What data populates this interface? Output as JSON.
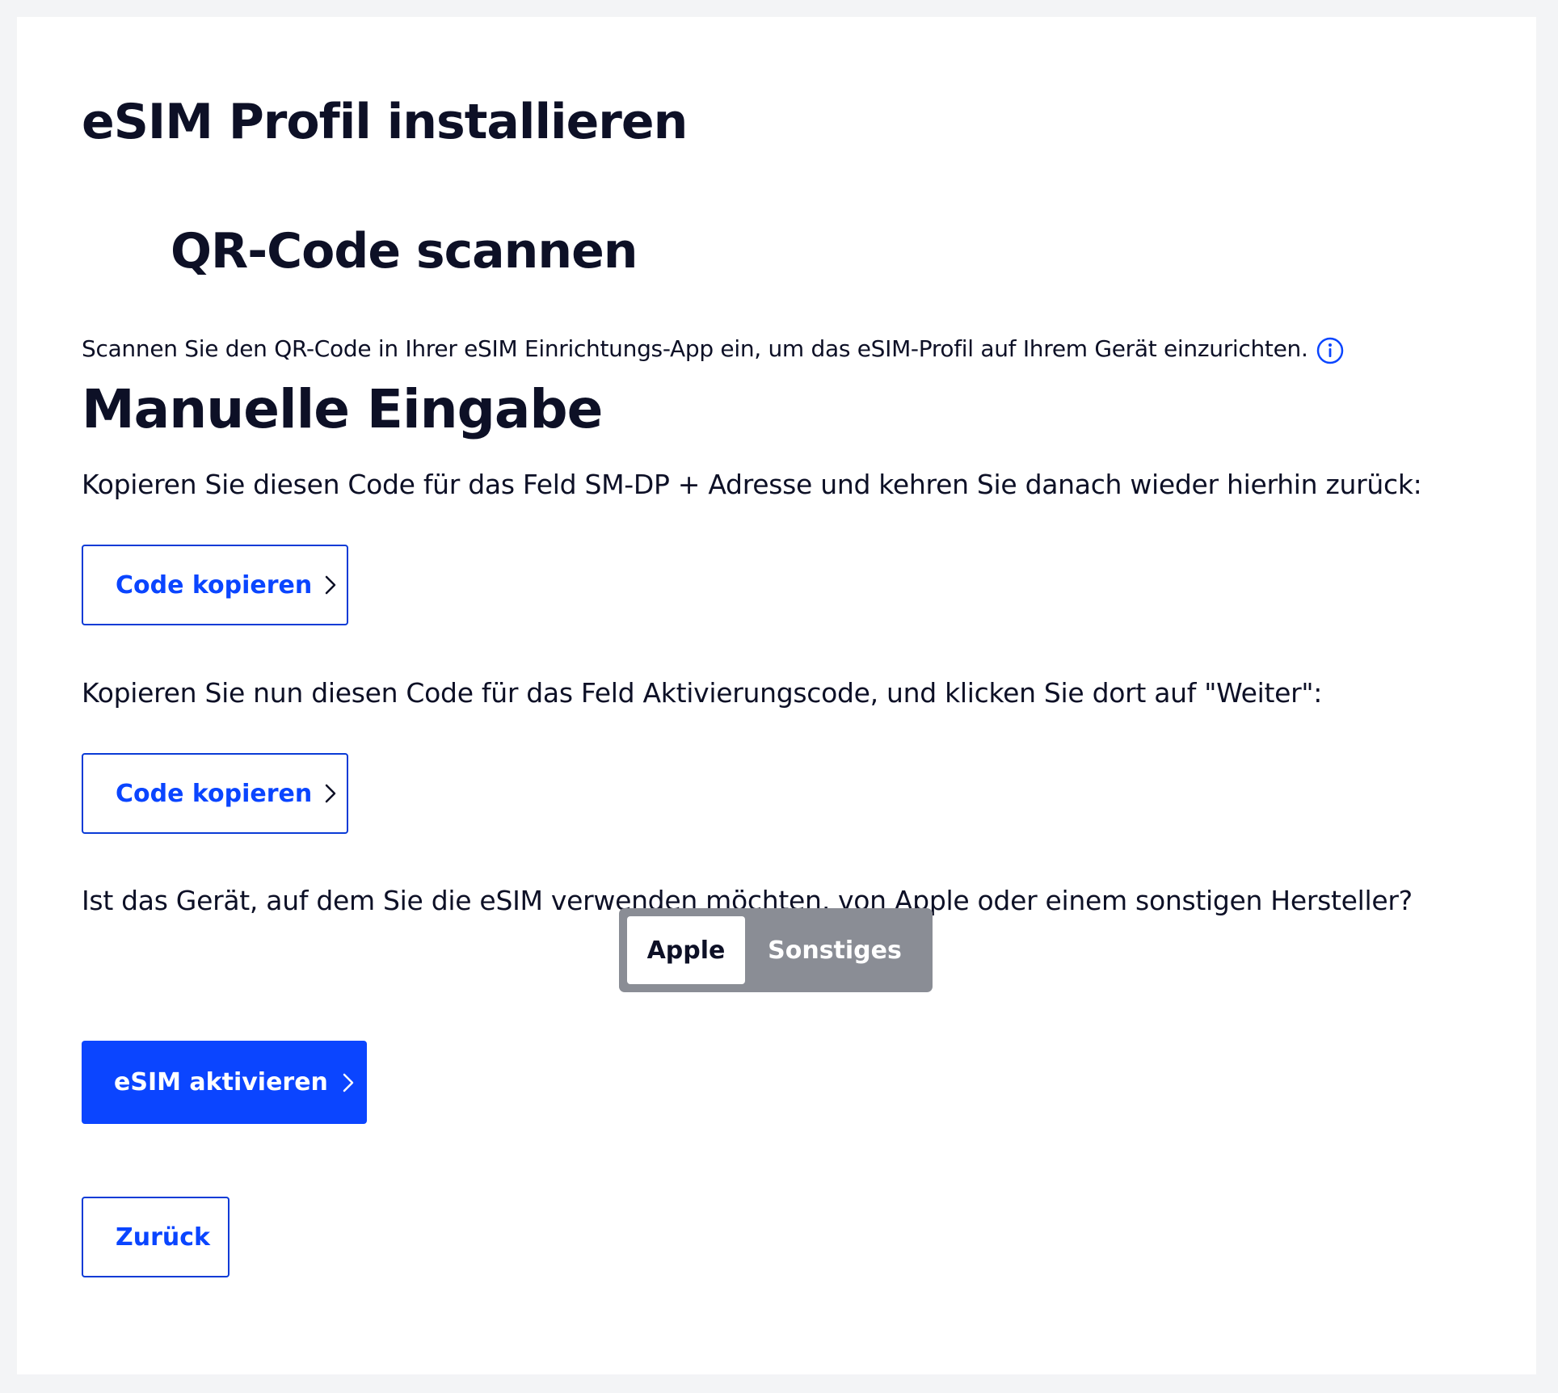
{
  "page": {
    "title": "eSIM Profil installieren"
  },
  "qr_section": {
    "heading": "QR-Code scannen",
    "description": "Scannen Sie den QR-Code in Ihrer eSIM Einrichtungs-App ein, um das eSIM-Profil auf Ihrem Gerät einzurichten.",
    "info_icon": "info-circle-icon"
  },
  "manual_section": {
    "heading": "Manuelle Eingabe",
    "step1_text": "Kopieren Sie diesen Code für das Feld SM-DP + Adresse und kehren Sie danach wieder hierhin zurück:",
    "step1_button": "Code kopieren",
    "step2_text": "Kopieren Sie nun diesen Code für das Feld Aktivierungscode, und klicken Sie dort auf \"Weiter\":",
    "step2_button": "Code kopieren",
    "device_question": "Ist das Gerät, auf dem Sie die eSIM verwenden möchten, von Apple oder einem sonstigen Hersteller?",
    "device_options": [
      "Apple",
      "Sonstiges"
    ],
    "device_selected": "Apple"
  },
  "actions": {
    "activate_label": "eSIM aktivieren",
    "back_label": "Zurück"
  },
  "colors": {
    "accent": "#0b45ff",
    "text": "#0d1026",
    "segment_bg": "#8a8d95",
    "page_bg": "#f3f4f6"
  }
}
